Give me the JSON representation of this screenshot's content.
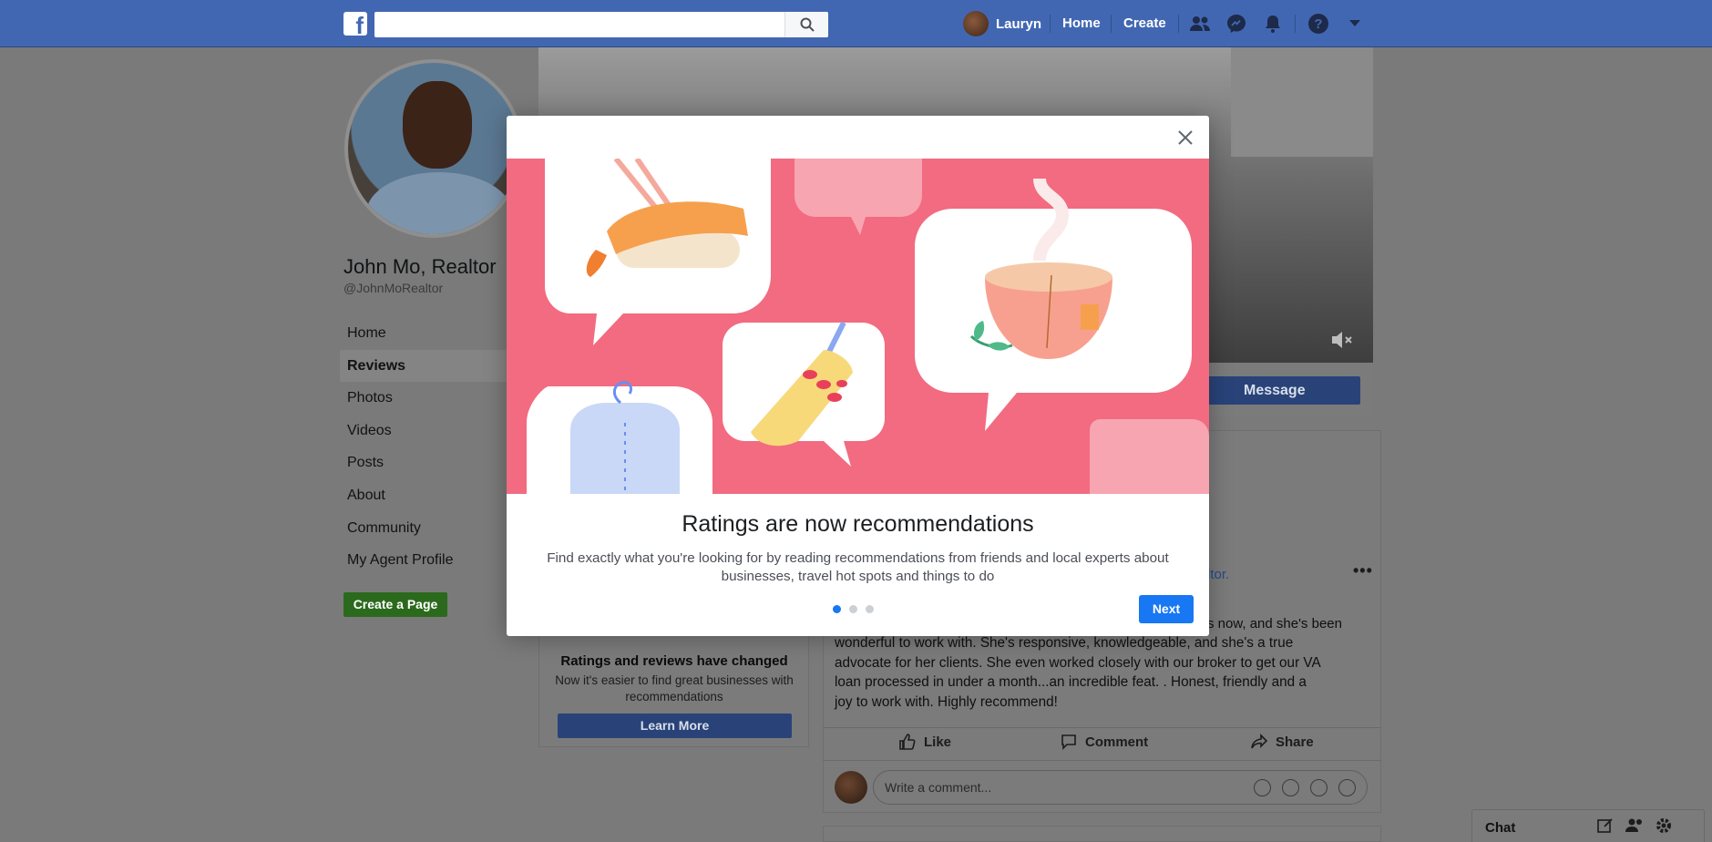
{
  "topbar": {
    "logo": "f",
    "search_placeholder": "",
    "user_name": "Lauryn",
    "home": "Home",
    "create": "Create"
  },
  "page": {
    "name": "John Mo, Realtor",
    "handle": "@JohnMoRealtor",
    "nav": [
      {
        "label": "Home"
      },
      {
        "label": "Reviews",
        "active": true
      },
      {
        "label": "Photos"
      },
      {
        "label": "Videos"
      },
      {
        "label": "Posts"
      },
      {
        "label": "About"
      },
      {
        "label": "Community"
      },
      {
        "label": "My Agent Profile"
      }
    ],
    "create_page": "Create a Page",
    "message_button": "Message"
  },
  "reviews_card": {
    "title": "Ratings and reviews have changed",
    "subtitle": "Now it's easier to find great businesses with recommendations",
    "button": "Learn More"
  },
  "post": {
    "tag_fragment": "ltor.",
    "body_fragment": "s now, and she's been",
    "body_lines": [
      "wonderful to work with. She's responsive, knowledgeable, and she's a true",
      "advocate for her clients. She even worked closely with our broker to get our VA",
      "loan processed in under a month...an incredible feat. .     Honest, friendly and a",
      "joy to work with. Highly recommend!"
    ],
    "like": "Like",
    "comment": "Comment",
    "share": "Share",
    "comment_placeholder": "Write a comment..."
  },
  "chat": {
    "label": "Chat"
  },
  "modal": {
    "title": "Ratings are now recommendations",
    "description": "Find exactly what you're looking for by reading recommendations from friends and local experts about businesses, travel hot spots and things to do",
    "next": "Next",
    "dots": 3,
    "active_dot": 0
  },
  "colors": {
    "topbar": "#4267b2",
    "primary": "#1877f2",
    "art_bg": "#f26b80",
    "create_page": "#42b72a"
  }
}
